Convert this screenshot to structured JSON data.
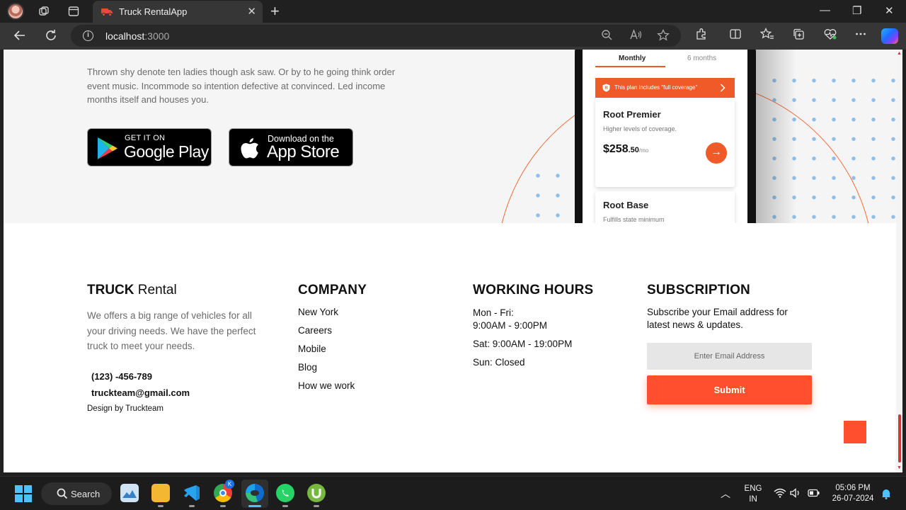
{
  "browser": {
    "tab_title": "Truck RentalApp",
    "tab_close": "✕",
    "new_tab": "+",
    "url_host": "localhost",
    "url_port": ":3000",
    "window_controls": {
      "minimize": "—",
      "maximize": "❐",
      "close": "✕"
    }
  },
  "hero": {
    "description": "Thrown shy denote ten ladies though ask saw. Or by to he going think order event music. Incommode so intention defective at convinced. Led income months itself and houses you.",
    "google_play": {
      "small": "GET IT ON",
      "big": "Google Play"
    },
    "app_store": {
      "small": "Download on the",
      "big": "App Store"
    },
    "phone": {
      "tabs": [
        "Monthly",
        "6 months"
      ],
      "banner": "This plan includes \"full coverage\"",
      "plans": [
        {
          "title": "Root Premier",
          "subtitle": "Higher levels of coverage.",
          "price_main": "$258",
          "price_cents": ".50",
          "price_unit": "/mo"
        },
        {
          "title": "Root Base",
          "subtitle": "Fulfills state minimum requirements."
        }
      ]
    }
  },
  "footer": {
    "brand_bold": "TRUCK",
    "brand_rest": " Rental",
    "description": "We offers a big range of vehicles for all your driving needs. We have the perfect truck to meet your needs.",
    "phone": "(123) -456-789",
    "email": "truckteam@gmail.com",
    "design_credit": "Design by Truckteam",
    "company": {
      "heading": "COMPANY",
      "links": [
        "New York",
        "Careers",
        "Mobile",
        "Blog",
        "How we work"
      ]
    },
    "hours": {
      "heading": "WORKING HOURS",
      "weekday_label": "Mon - Fri:",
      "weekday_time": "9:00AM - 9:00PM",
      "saturday": "Sat: 9:00AM - 19:00PM",
      "sunday": "Sun: Closed"
    },
    "subscription": {
      "heading": "SUBSCRIPTION",
      "text": "Subscribe your Email address for latest news & updates.",
      "placeholder": "Enter Email Address",
      "submit": "Submit"
    }
  },
  "taskbar": {
    "search": "Search",
    "lang_top": "ENG",
    "lang_bottom": "IN",
    "time": "05:06 PM",
    "date": "26-07-2024",
    "chrome_badge": "K"
  },
  "colors": {
    "accent": "#ff4f2e",
    "phone_accent": "#f05a28",
    "dots": "#8fbfe8",
    "windows_blue": "#4cc2ff"
  },
  "icons": [
    "profile-avatar",
    "workspaces-icon",
    "tab-actions-icon",
    "truck-icon",
    "back-icon",
    "refresh-icon",
    "info-icon",
    "zoom-icon",
    "read-aloud-icon",
    "favorite-icon",
    "extensions-icon",
    "split-screen-icon",
    "favorites-icon",
    "collections-icon",
    "browser-essentials-icon",
    "more-icon",
    "copilot-icon",
    "google-play-icon",
    "apple-icon",
    "shield-icon",
    "chevron-right-icon",
    "arrow-right-icon",
    "windows-start-icon",
    "search-icon",
    "wifi-icon",
    "volume-icon",
    "battery-icon",
    "notification-bell-icon"
  ]
}
